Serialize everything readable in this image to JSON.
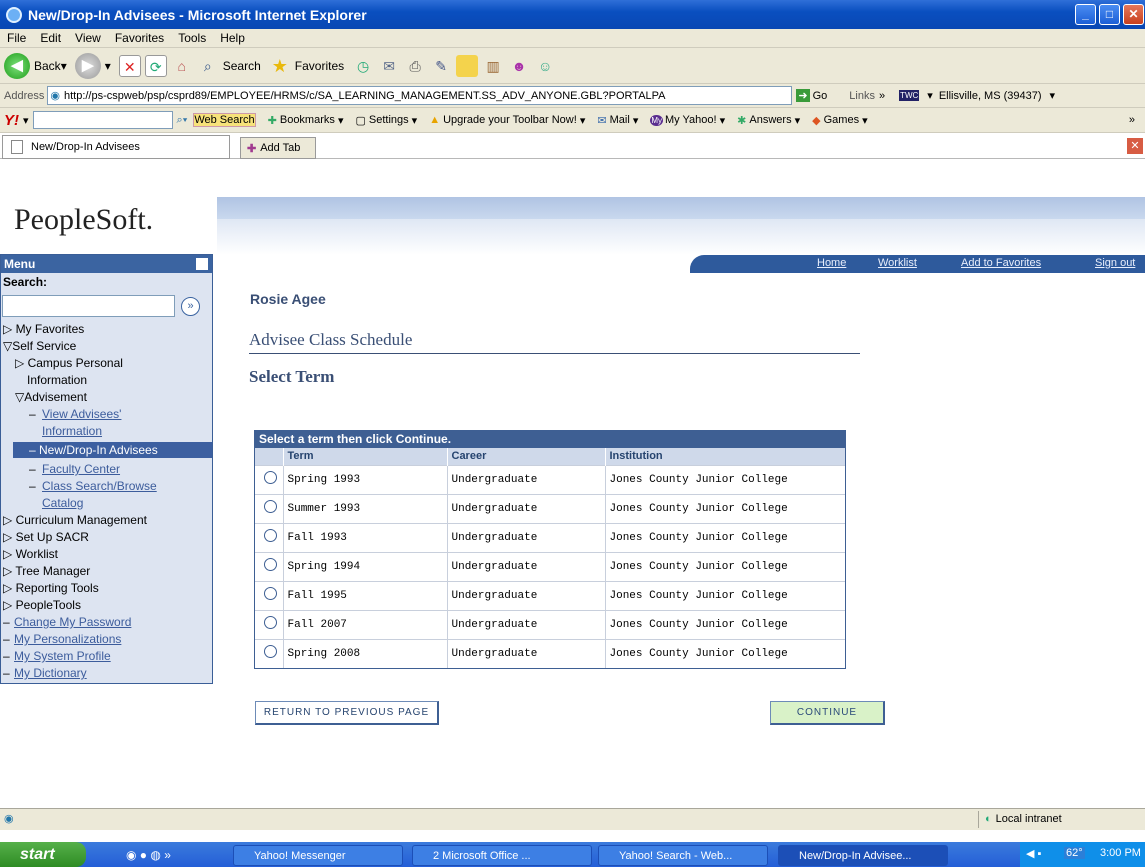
{
  "window": {
    "title": "New/Drop-In Advisees - Microsoft Internet Explorer"
  },
  "menubar": [
    "File",
    "Edit",
    "View",
    "Favorites",
    "Tools",
    "Help"
  ],
  "toolbar": {
    "back": "Back",
    "search": "Search",
    "favorites": "Favorites"
  },
  "address": {
    "label": "Address",
    "url": "http://ps-cspweb/psp/csprd89/EMPLOYEE/HRMS/c/SA_LEARNING_MANAGEMENT.SS_ADV_ANYONE.GBL?PORTALPA",
    "go": "Go",
    "links": "Links",
    "location": "Ellisville, MS (39437)"
  },
  "yahoo": {
    "web_search": "Web Search",
    "bookmarks": "Bookmarks",
    "settings": "Settings",
    "upgrade": "Upgrade your Toolbar Now!",
    "mail": "Mail",
    "my_yahoo": "My Yahoo!",
    "answers": "Answers",
    "games": "Games"
  },
  "tabs": {
    "active": "New/Drop-In Advisees",
    "add": "Add Tab"
  },
  "ps": {
    "logo": "PeopleSoft.",
    "nav": [
      "Home",
      "Worklist",
      "Add to Favorites",
      "Sign out"
    ]
  },
  "menu": {
    "title": "Menu",
    "search_label": "Search:",
    "items": [
      {
        "label": "My Favorites"
      },
      {
        "label": "Self Service"
      },
      {
        "label": "Campus Personal"
      },
      {
        "label": "Information"
      },
      {
        "label": "Advisement"
      },
      {
        "label": "View Advisees'"
      },
      {
        "label": "Information"
      },
      {
        "label": "New/Drop-In Advisees"
      },
      {
        "label": "Faculty Center"
      },
      {
        "label": "Class Search/Browse"
      },
      {
        "label": "Catalog"
      },
      {
        "label": "Curriculum Management"
      },
      {
        "label": "Set Up SACR"
      },
      {
        "label": "Worklist"
      },
      {
        "label": "Tree Manager"
      },
      {
        "label": "Reporting Tools"
      },
      {
        "label": "PeopleTools"
      },
      {
        "label": "Change My Password"
      },
      {
        "label": "My Personalizations"
      },
      {
        "label": "My System Profile"
      },
      {
        "label": "My Dictionary"
      }
    ]
  },
  "content": {
    "student_name": "Rosie Agee",
    "page_title": "Advisee Class Schedule",
    "subtitle": "Select Term",
    "grid_title": "Select a term then click Continue.",
    "columns": [
      "Term",
      "Career",
      "Institution"
    ],
    "rows": [
      {
        "term": "Spring 1993",
        "career": "Undergraduate",
        "institution": "Jones County Junior College"
      },
      {
        "term": "Summer 1993",
        "career": "Undergraduate",
        "institution": "Jones County Junior College"
      },
      {
        "term": "Fall 1993",
        "career": "Undergraduate",
        "institution": "Jones County Junior College"
      },
      {
        "term": "Spring 1994",
        "career": "Undergraduate",
        "institution": "Jones County Junior College"
      },
      {
        "term": "Fall 1995",
        "career": "Undergraduate",
        "institution": "Jones County Junior College"
      },
      {
        "term": "Fall 2007",
        "career": "Undergraduate",
        "institution": "Jones County Junior College"
      },
      {
        "term": "Spring 2008",
        "career": "Undergraduate",
        "institution": "Jones County Junior College"
      }
    ],
    "return_button": "Return To Previous Page",
    "continue_button": "Continue"
  },
  "status": {
    "zone": "Local intranet"
  },
  "taskbar": {
    "start": "start",
    "tasks": [
      "Yahoo! Messenger",
      "2 Microsoft Office ...",
      "Yahoo! Search - Web...",
      "New/Drop-In Advisee..."
    ],
    "temp": "62°",
    "time": "3:00 PM"
  },
  "colors": {
    "ps_blue": "#3b64a1",
    "header_text": "#3a4f75",
    "continue_bg": "#d9f2c8"
  }
}
